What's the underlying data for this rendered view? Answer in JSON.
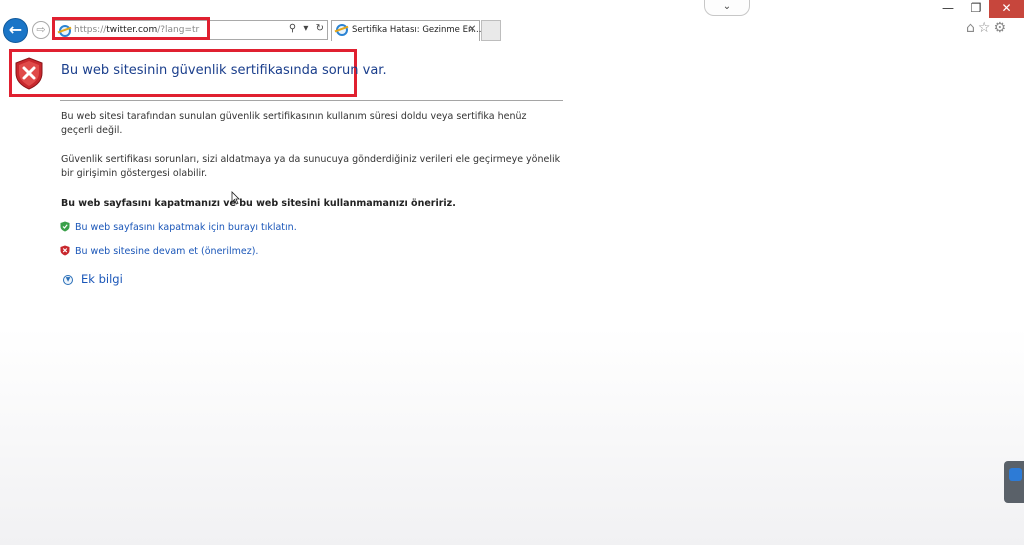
{
  "browser": {
    "pull_tab_icon": "chevron-down-icon",
    "pull_tab_glyph": "⌄",
    "window_controls": {
      "minimize": "—",
      "maximize": "❐",
      "close": "✕"
    },
    "back_glyph": "←",
    "forward_glyph": "⇨",
    "address": {
      "prefix": "https://",
      "domain": "twitter.com",
      "suffix": "/?lang=tr"
    },
    "address_icons": {
      "search": "⚲",
      "dropdown": "▾",
      "refresh": "↻"
    },
    "tab": {
      "title": "Sertifika Hatası: Gezinme En...",
      "close": "✕"
    },
    "toolbar_icons": "⌂☆⚙"
  },
  "page": {
    "title": "Bu web sitesinin güvenlik sertifikasında sorun var.",
    "paragraph1": "Bu web sitesi tarafından sunulan güvenlik sertifikasının kullanım süresi doldu veya sertifika henüz geçerli değil.",
    "paragraph2": "Güvenlik sertifikası sorunları, sizi aldatmaya ya da sunucuya gönderdiğiniz verileri ele geçirmeye yönelik bir girişimin göstergesi olabilir.",
    "recommendation": "Bu web sayfasını kapatmanızı ve bu web sitesini kullanmamanızı öneririz.",
    "link_close": "Bu web sayfasını kapatmak için burayı tıklatın.",
    "link_continue": "Bu web sitesine devam et (önerilmez).",
    "more_info_glyph": "▼",
    "more_info": "Ek bilgi"
  },
  "colors": {
    "highlight_red": "#e02030",
    "link_blue": "#1a56b8",
    "title_blue": "#1a3e8c",
    "shield_red": "#c8282e",
    "shield_green": "#3aa04a"
  }
}
